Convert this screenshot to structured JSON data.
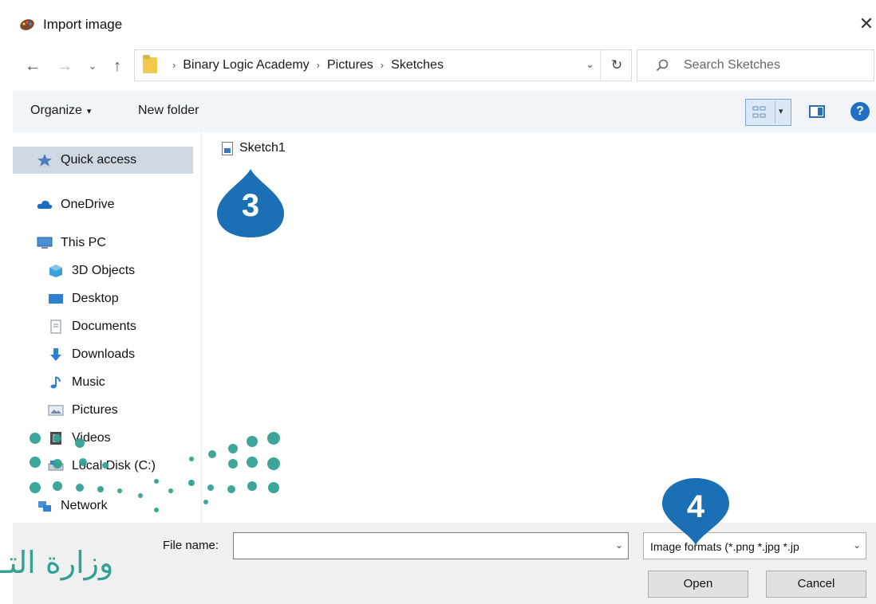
{
  "dialog": {
    "title": "Import image",
    "close_glyph": "✕",
    "title_icon": "paint-palette-icon"
  },
  "navigation": {
    "back_glyph": "←",
    "forward_glyph": "→",
    "recent_glyph": "⌄",
    "up_glyph": "↑"
  },
  "address": {
    "breadcrumbs": [
      "Binary Logic Academy",
      "Pictures",
      "Sketches"
    ],
    "separator": "›",
    "dropdown_glyph": "⌄",
    "refresh_glyph": "↻"
  },
  "search": {
    "placeholder": "Search Sketches"
  },
  "toolbar": {
    "organize_label": "Organize",
    "organize_caret": "▾",
    "new_folder_label": "New folder",
    "view_caret": "▾",
    "help_glyph": "?"
  },
  "sidebar": {
    "items": [
      {
        "label": "Quick access",
        "icon": "star-icon",
        "selected": true
      },
      {
        "label": "OneDrive",
        "icon": "cloud-icon",
        "selected": false
      },
      {
        "label": "This PC",
        "icon": "computer-icon",
        "selected": false
      },
      {
        "label": "3D Objects",
        "icon": "cube-icon",
        "selected": false
      },
      {
        "label": "Desktop",
        "icon": "desktop-icon",
        "selected": false
      },
      {
        "label": "Documents",
        "icon": "document-icon",
        "selected": false
      },
      {
        "label": "Downloads",
        "icon": "download-icon",
        "selected": false
      },
      {
        "label": "Music",
        "icon": "music-note-icon",
        "selected": false
      },
      {
        "label": "Pictures",
        "icon": "picture-icon",
        "selected": false
      },
      {
        "label": "Videos",
        "icon": "video-icon",
        "selected": false
      },
      {
        "label": "Local Disk (C:)",
        "icon": "disk-icon",
        "selected": false
      },
      {
        "label": "Network",
        "icon": "network-icon",
        "selected": false
      }
    ]
  },
  "files": [
    {
      "name": "Sketch1",
      "icon": "image-file-icon"
    }
  ],
  "markers": {
    "step3": "3",
    "step4": "4",
    "color": "#1b6fb5"
  },
  "footer": {
    "file_name_label": "File name:",
    "file_name_value": "",
    "filetype_value": "Image formats (*.png *.jpg *.jp",
    "open_label": "Open",
    "cancel_label": "Cancel",
    "dropdown_glyph": "⌄"
  },
  "watermark": {
    "text": "وزارة التـ",
    "color": "#2a9d8f"
  }
}
